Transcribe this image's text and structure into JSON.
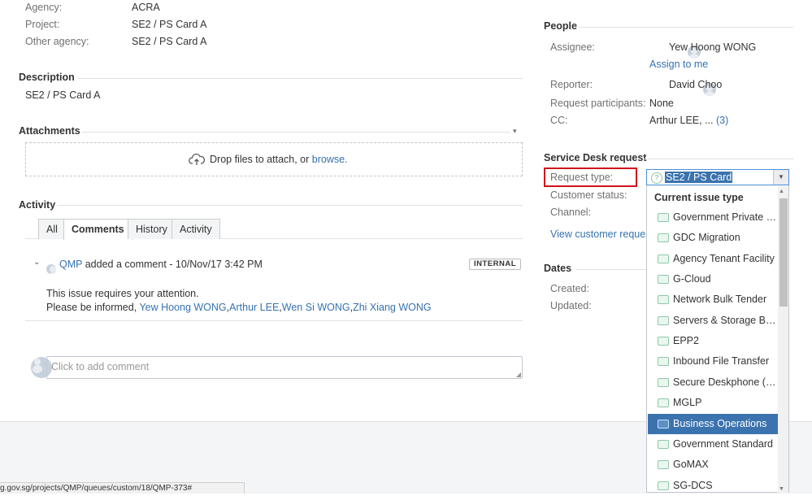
{
  "details": {
    "agency_label": "Agency:",
    "agency_value": "ACRA",
    "project_label": "Project:",
    "project_value": "SE2 / PS Card A",
    "other_agency_label": "Other agency:",
    "other_agency_value": "SE2 / PS Card A"
  },
  "description": {
    "heading": "Description",
    "text": "SE2 / PS Card A"
  },
  "attachments": {
    "heading": "Attachments",
    "drop_text": "Drop files to attach, or",
    "browse_link": "browse."
  },
  "activity": {
    "heading": "Activity",
    "tabs": [
      "All",
      "Comments",
      "History",
      "Activity"
    ],
    "active_tab": "Comments",
    "comment": {
      "author": "QMP",
      "action": "added a comment - 10/Nov/17 3:42 PM",
      "badge": "INTERNAL",
      "line1": "This issue requires your attention.",
      "line2_prefix": "Please be informed,",
      "mentions": [
        "Yew Hoong WONG",
        "Arthur LEE",
        "Wen Si WONG",
        "Zhi Xiang WONG"
      ]
    },
    "add_comment_placeholder": "Click to add comment"
  },
  "people": {
    "heading": "People",
    "assignee_label": "Assignee:",
    "assignee": "Yew Hoong WONG",
    "assign_to_me": "Assign to me",
    "reporter_label": "Reporter:",
    "reporter": "David Choo",
    "participants_label": "Request participants:",
    "participants": "None",
    "cc_label": "CC:",
    "cc_value": "Arthur LEE, ...",
    "cc_count": "(3)"
  },
  "service_desk": {
    "heading": "Service Desk request",
    "request_type_label": "Request type:",
    "request_type_value": "SE2 / PS Card",
    "customer_status_label": "Customer status:",
    "channel_label": "Channel:",
    "view_link": "View customer request"
  },
  "dates": {
    "heading": "Dates",
    "created_label": "Created:",
    "updated_label": "Updated:"
  },
  "dropdown": {
    "group_label": "Current issue type",
    "selected_index": 10,
    "options": [
      "Government Private Cloud",
      "GDC Migration",
      "Agency Tenant Facility",
      "G-Cloud",
      "Network Bulk Tender",
      "Servers & Storage Bulk Tender",
      "EPP2",
      "Inbound File Transfer",
      "Secure Deskphone (SDP)",
      "MGLP",
      "Business Operations",
      "Government Standard",
      "GoMAX",
      "SG-DCS"
    ]
  },
  "status_bar": {
    "url": "g.gov.sg/projects/QMP/queues/custom/18/QMP-373#"
  },
  "colors": {
    "link": "#3572b0",
    "selected": "#3b73af",
    "highlight_border": "#d0121b"
  }
}
